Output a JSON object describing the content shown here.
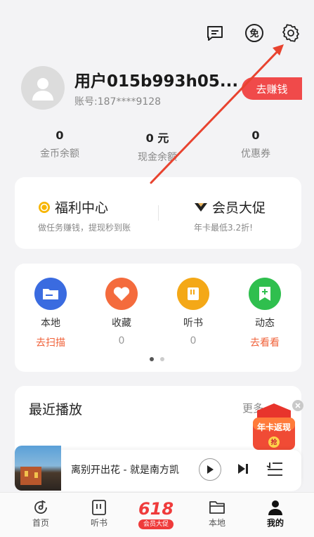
{
  "header_icons": {
    "message": "message-icon",
    "free": "free-mode-icon",
    "settings": "settings-gear-icon"
  },
  "user": {
    "name": "用户015b993h05...",
    "account": "账号:187****9128",
    "earn_button": "去赚钱"
  },
  "stats": [
    {
      "value": "0",
      "label": "金币余额"
    },
    {
      "value": "0 元",
      "label": "现金余额"
    },
    {
      "value": "0",
      "label": "优惠券"
    }
  ],
  "promos": {
    "welfare": {
      "title": "福利中心",
      "subtitle": "做任务赚钱，提现秒到账"
    },
    "vip": {
      "title": "会员大促",
      "subtitle": "年卡最低3.2折!"
    }
  },
  "grid": [
    {
      "label": "本地",
      "sub": "去扫描",
      "color": "#3a6be0",
      "sub_color": "#f0623a"
    },
    {
      "label": "收藏",
      "sub": "0",
      "color": "#f46b3d",
      "sub_color": "#999999"
    },
    {
      "label": "听书",
      "sub": "0",
      "color": "#f4a817",
      "sub_color": "#999999"
    },
    {
      "label": "动态",
      "sub": "去看看",
      "color": "#2fbf4e",
      "sub_color": "#f0623a"
    }
  ],
  "recent": {
    "title": "最近播放",
    "more": "更多",
    "badge": "年卡返现",
    "badge_small": "抢"
  },
  "player": {
    "song": "离别开出花 - 就是南方凯"
  },
  "nav": [
    {
      "label": "首页"
    },
    {
      "label": "听书"
    },
    {
      "label": "618",
      "sub": "会员大促"
    },
    {
      "label": "本地"
    },
    {
      "label": "我的"
    }
  ]
}
